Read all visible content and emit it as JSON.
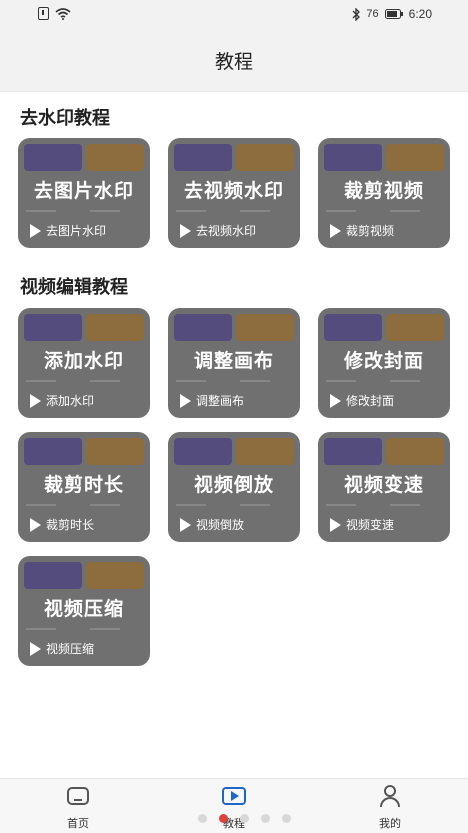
{
  "status_bar": {
    "time": "6:20",
    "battery": "76"
  },
  "header": {
    "title": "教程"
  },
  "sections": [
    {
      "title": "去水印教程",
      "cards": [
        {
          "title": "去图片水印",
          "subtitle": "去图片水印"
        },
        {
          "title": "去视频水印",
          "subtitle": "去视频水印"
        },
        {
          "title": "裁剪视频",
          "subtitle": "裁剪视频"
        }
      ]
    },
    {
      "title": "视频编辑教程",
      "cards": [
        {
          "title": "添加水印",
          "subtitle": "添加水印"
        },
        {
          "title": "调整画布",
          "subtitle": "调整画布"
        },
        {
          "title": "修改封面",
          "subtitle": "修改封面"
        },
        {
          "title": "裁剪时长",
          "subtitle": "裁剪时长"
        },
        {
          "title": "视频倒放",
          "subtitle": "视频倒放"
        },
        {
          "title": "视频变速",
          "subtitle": "视频变速"
        },
        {
          "title": "视频压缩",
          "subtitle": "视频压缩"
        }
      ]
    }
  ],
  "tabbar": {
    "home_label": "首页",
    "course_label": "教程",
    "mine_label": "我的",
    "active_tab": "教程"
  },
  "colors": {
    "card_bg": "#707070",
    "active_accent": "#1f66c9",
    "page_dot_active": "#e0403a"
  },
  "icons": [
    "sim-card-icon",
    "wifi-icon",
    "bluetooth-icon",
    "signal-icon",
    "battery-icon",
    "play-icon",
    "home-icon",
    "video-icon",
    "user-icon"
  ]
}
